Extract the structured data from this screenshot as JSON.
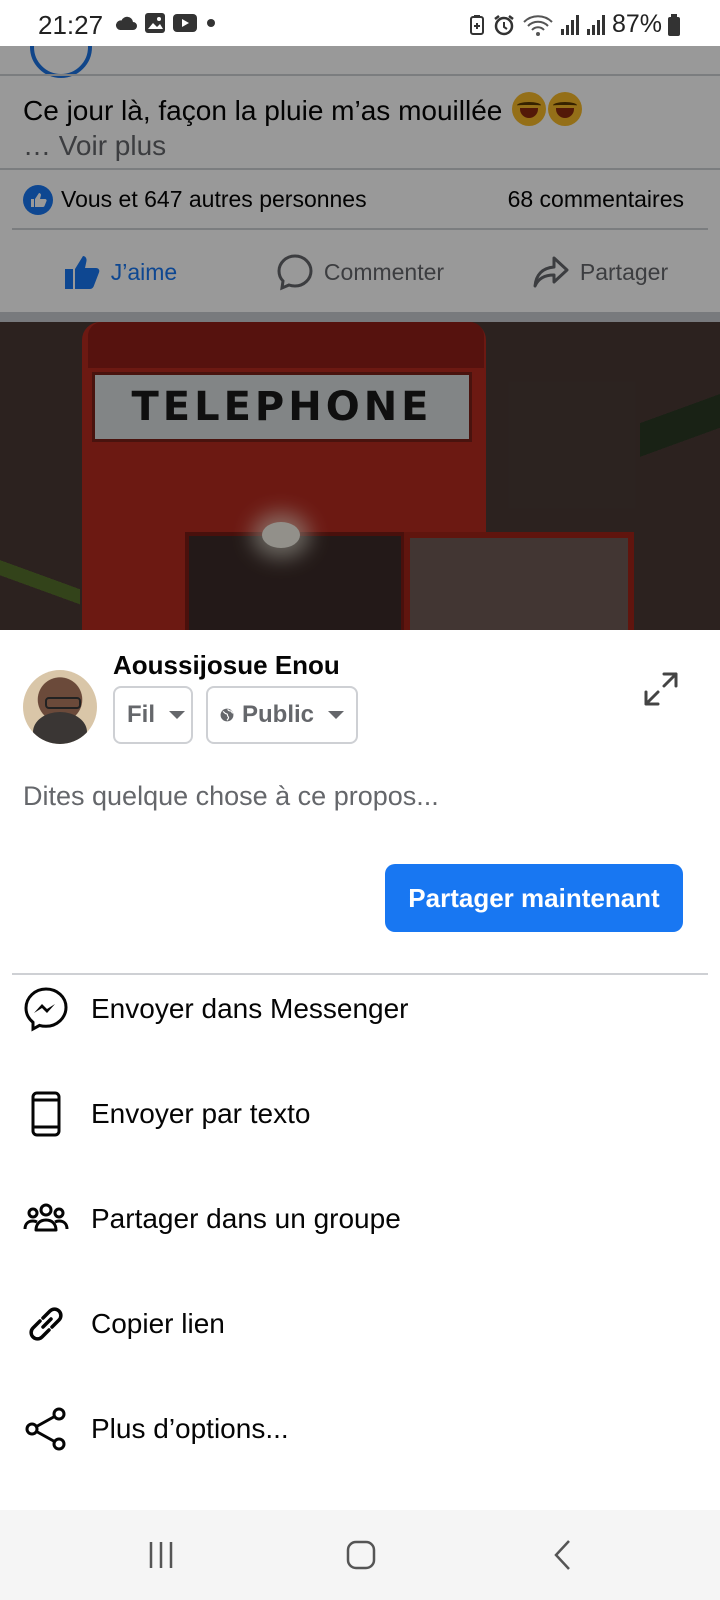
{
  "status_bar": {
    "time": "21:27",
    "battery": "87%",
    "icons": [
      "cloud-icon",
      "gallery-icon",
      "youtube-icon",
      "dot-icon",
      "battery-saver-icon",
      "alarm-icon",
      "wifi-icon",
      "signal-icon",
      "signal-icon",
      "battery-icon"
    ]
  },
  "post": {
    "text": "Ce jour là, façon la pluie m’as mouillée",
    "see_more": "… Voir plus",
    "reactions_text": "Vous et 647 autres personnes",
    "comments_count": "68 commentaires",
    "actions": {
      "like": "J’aime",
      "comment": "Commenter",
      "share": "Partager"
    },
    "photo_sign_text": "TELEPHONE"
  },
  "share_sheet": {
    "user_name": "Aoussijosue Enou",
    "destination": "Fil",
    "audience": "Public",
    "placeholder": "Dites quelque chose à ce propos...",
    "share_now_label": "Partager maintenant",
    "options": [
      {
        "label": "Envoyer dans Messenger",
        "icon": "messenger-icon"
      },
      {
        "label": "Envoyer par texto",
        "icon": "phone-icon"
      },
      {
        "label": "Partager dans un groupe",
        "icon": "group-icon"
      },
      {
        "label": "Copier lien",
        "icon": "link-icon"
      },
      {
        "label": "Plus d’options...",
        "icon": "share-icon"
      }
    ]
  },
  "colors": {
    "accent": "#1877f2",
    "secondary_text": "#65676b",
    "divider": "#ced0d4"
  }
}
